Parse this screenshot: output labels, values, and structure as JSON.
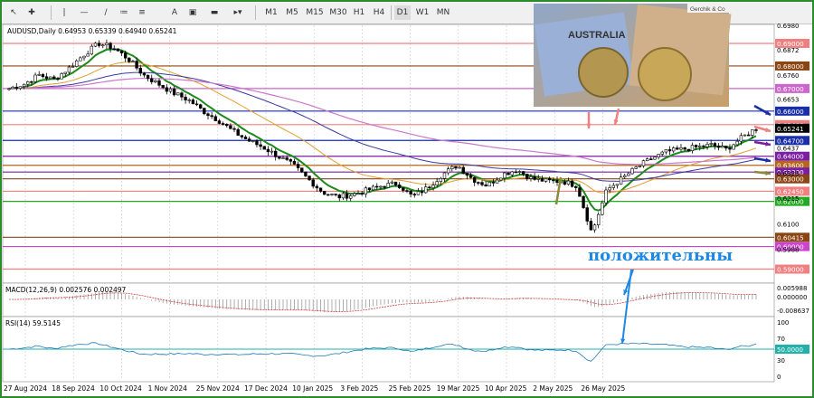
{
  "toolbar": {
    "timeframes": [
      "M1",
      "M5",
      "M15",
      "M30",
      "H1",
      "H4",
      "D1",
      "W1",
      "MN"
    ]
  },
  "chart_data": {
    "type": "candlestick",
    "symbol_line": "AUDUSD,Daily  0.64953 0.65339 0.64940 0.65241",
    "price_axis": {
      "ylim": [
        0.585,
        0.698
      ],
      "ticks": [
        0.698,
        0.6872,
        0.676,
        0.6653,
        0.6437,
        0.6325,
        0.6215,
        0.61,
        0.5988
      ],
      "levels": [
        {
          "value": 0.69,
          "color": "#f08080",
          "label": "0.69000"
        },
        {
          "value": 0.68,
          "color": "#8b4513",
          "label": "0.68000"
        },
        {
          "value": 0.67,
          "color": "#cc66cc",
          "label": "0.67000"
        },
        {
          "value": 0.66,
          "color": "#1a2ea8",
          "label": "0.66000"
        },
        {
          "value": 0.654,
          "color": "#f08080",
          "label": "0.65400"
        },
        {
          "value": 0.647,
          "color": "#1a2ea8",
          "label": "0.64700"
        },
        {
          "value": 0.64,
          "color": "#7b1fa2",
          "label": "0.64000"
        },
        {
          "value": 0.636,
          "color": "#b5651d",
          "label": "0.63600"
        },
        {
          "value": 0.633,
          "color": "#7b1fa2",
          "label": "0.63300"
        },
        {
          "value": 0.63,
          "color": "#8b4513",
          "label": "0.63000"
        },
        {
          "value": 0.6245,
          "color": "#f08080",
          "label": "0.62450"
        },
        {
          "value": 0.62,
          "color": "#22aa22",
          "label": "0.62000"
        },
        {
          "value": 0.6041,
          "color": "#8b4513",
          "label": "0.60415"
        },
        {
          "value": 0.6,
          "color": "#cc44cc",
          "label": "0.60000"
        },
        {
          "value": 0.59,
          "color": "#f08080",
          "label": "0.59000"
        }
      ],
      "current_price": {
        "value": 0.6524,
        "label": "0.65241"
      }
    },
    "x_labels": [
      "27 Aug 2024",
      "18 Sep 2024",
      "10 Oct 2024",
      "1 Nov 2024",
      "25 Nov 2024",
      "17 Dec 2024",
      "10 Jan 2025",
      "3 Feb 2025",
      "25 Feb 2025",
      "19 Mar 2025",
      "10 Apr 2025",
      "2 May 2025",
      "26 May 2025"
    ],
    "close_series": [
      0.67,
      0.672,
      0.676,
      0.674,
      0.679,
      0.685,
      0.69,
      0.688,
      0.683,
      0.676,
      0.672,
      0.668,
      0.665,
      0.66,
      0.656,
      0.651,
      0.647,
      0.644,
      0.64,
      0.636,
      0.63,
      0.624,
      0.622,
      0.623,
      0.625,
      0.627,
      0.628,
      0.622,
      0.626,
      0.632,
      0.636,
      0.63,
      0.627,
      0.632,
      0.634,
      0.63,
      0.629,
      0.629,
      0.627,
      0.606,
      0.625,
      0.63,
      0.635,
      0.639,
      0.642,
      0.643,
      0.644,
      0.645,
      0.643,
      0.648,
      0.6524
    ],
    "indicators": {
      "macd": {
        "label": "MACD(12,26,9) 0.002576 0.002497",
        "ticks": [
          "0.005988",
          "0.000000",
          "-0.008637"
        ],
        "current": 0.0026
      },
      "rsi": {
        "label": "RSI(14) 59.5145",
        "ticks": [
          "100",
          "70",
          "50.0000",
          "30",
          "0"
        ],
        "level": 50,
        "current": 59.5
      }
    }
  },
  "inset": {
    "word": "AUSTRALIA",
    "logo": "Gerchik & Co"
  },
  "annotation": {
    "text": "положительны"
  },
  "colors": {
    "ema_fast": "#1b8a1b",
    "ema_mid": "#e0a030",
    "ema_slow": "#3a3aa0",
    "ema_long": "#cc77cc",
    "candle": "#000000",
    "annotation": "#1e88e5",
    "arrow_pink": "#f08080",
    "arrow_olive": "#8a8a3a"
  }
}
